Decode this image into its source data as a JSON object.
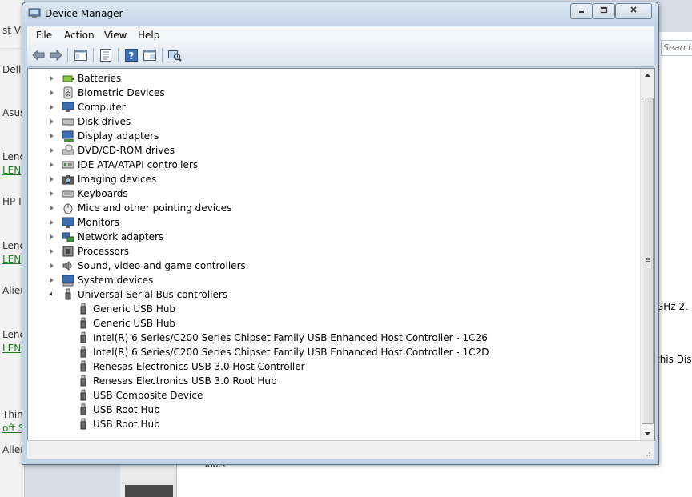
{
  "window": {
    "title": "Device Manager"
  },
  "menu": [
    "File",
    "Action",
    "View",
    "Help"
  ],
  "toolbar": [
    {
      "icon": "back-arrow-icon"
    },
    {
      "icon": "forward-arrow-icon"
    },
    {
      "icon": "show-hide-tree-icon"
    },
    {
      "icon": "properties-icon"
    },
    {
      "icon": "help-icon"
    },
    {
      "icon": "view-console-icon"
    },
    {
      "icon": "scan-hardware-icon"
    }
  ],
  "tree": {
    "categories": [
      {
        "label": "Batteries",
        "icon": "battery-icon"
      },
      {
        "label": "Biometric Devices",
        "icon": "biometric-icon"
      },
      {
        "label": "Computer",
        "icon": "computer-icon"
      },
      {
        "label": "Disk drives",
        "icon": "disk-drive-icon"
      },
      {
        "label": "Display adapters",
        "icon": "display-adapter-icon"
      },
      {
        "label": "DVD/CD-ROM drives",
        "icon": "dvd-drive-icon"
      },
      {
        "label": "IDE ATA/ATAPI controllers",
        "icon": "ide-controller-icon"
      },
      {
        "label": "Imaging devices",
        "icon": "camera-icon"
      },
      {
        "label": "Keyboards",
        "icon": "keyboard-icon"
      },
      {
        "label": "Mice and other pointing devices",
        "icon": "mouse-icon"
      },
      {
        "label": "Monitors",
        "icon": "monitor-icon"
      },
      {
        "label": "Network adapters",
        "icon": "network-adapter-icon"
      },
      {
        "label": "Processors",
        "icon": "processor-icon"
      },
      {
        "label": "Sound, video and game controllers",
        "icon": "sound-icon"
      },
      {
        "label": "System devices",
        "icon": "system-devices-icon"
      },
      {
        "label": "Universal Serial Bus controllers",
        "icon": "usb-icon",
        "expanded": true
      }
    ],
    "usb_children": [
      "Generic USB Hub",
      "Generic USB Hub",
      "Intel(R) 6 Series/C200 Series Chipset Family USB Enhanced Host Controller - 1C26",
      "Intel(R) 6 Series/C200 Series Chipset Family USB Enhanced Host Controller - 1C2D",
      "Renesas Electronics USB 3.0 Host Controller",
      "Renesas Electronics USB 3.0 Root Hub",
      "USB Composite Device",
      "USB Root Hub",
      "USB Root Hub"
    ]
  },
  "background": {
    "left_items": [
      "st Vis",
      "Dell",
      "Asus",
      "Lenc",
      "LEN",
      "HP I",
      "Lenc",
      "LEN",
      "Alien",
      "Lenc",
      "LEN",
      "Thin",
      "oft St",
      "Alien"
    ],
    "search_placeholder": "Search",
    "right_text": [
      "GHz  2.",
      "this Disp"
    ],
    "bottom_text": "Tools"
  },
  "colors": {
    "accent": "#3c6fb4",
    "window_frame": "#c3d4e7",
    "link_green": "#1a7f1a"
  }
}
